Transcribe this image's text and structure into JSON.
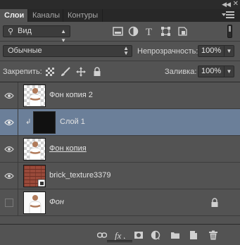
{
  "tabs": [
    {
      "label": "Слои",
      "active": true
    },
    {
      "label": "Каналы",
      "active": false
    },
    {
      "label": "Контуры",
      "active": false
    }
  ],
  "filter": {
    "kind_label": "Вид",
    "icons": [
      "image-filter-icon",
      "adjustment-filter-icon",
      "type-filter-icon",
      "shape-filter-icon",
      "smart-object-filter-icon"
    ]
  },
  "blend": {
    "mode": "Обычные",
    "opacity_label": "Непрозрачность:",
    "opacity_value": "100%",
    "fill_label": "Заливка:",
    "fill_value": "100%"
  },
  "lock": {
    "label": "Закрепить:",
    "icons": [
      "lock-transparency-icon",
      "lock-pixels-icon",
      "lock-position-icon",
      "lock-all-icon"
    ]
  },
  "layers": [
    {
      "name": "Фон копия 2",
      "visible": true,
      "selected": false,
      "thumb": "person-on-transparency"
    },
    {
      "name": "Слой 1",
      "visible": true,
      "selected": true,
      "thumb": "black-fill",
      "clipped": true
    },
    {
      "name": "Фон копия",
      "visible": true,
      "selected": false,
      "thumb": "person-on-transparency"
    },
    {
      "name": "brick_texture3379",
      "visible": true,
      "selected": false,
      "thumb": "brick"
    },
    {
      "name": "Фон",
      "visible": false,
      "selected": false,
      "thumb": "person-on-white",
      "locked": true
    }
  ],
  "bottom_icons": [
    "link-layers-icon",
    "fx-icon",
    "add-mask-icon",
    "adjustment-layer-icon",
    "new-group-icon",
    "new-layer-icon",
    "delete-layer-icon"
  ],
  "colors": {
    "panel_bg": "#535353",
    "selected_row": "#6b7f99",
    "tab_bar": "#282828"
  }
}
